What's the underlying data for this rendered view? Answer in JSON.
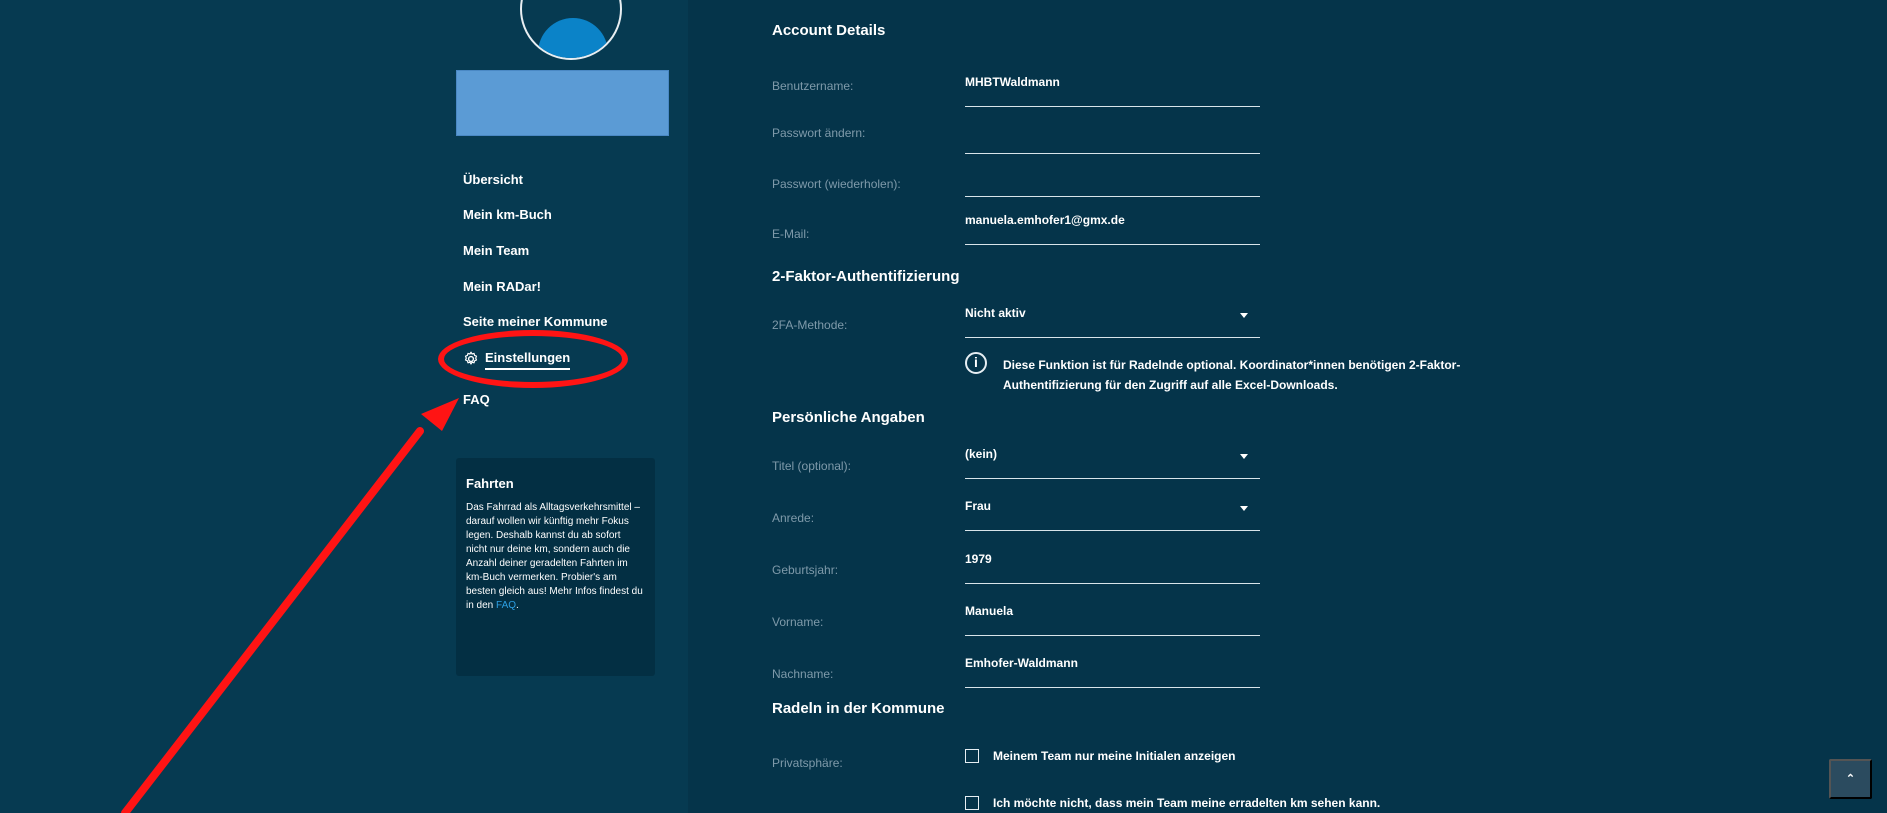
{
  "sidebar": {
    "nav": {
      "ubersicht": "Übersicht",
      "km_buch": "Mein km-Buch",
      "team": "Mein Team",
      "radar": "Mein RADar!",
      "kommune": "Seite meiner Kommune",
      "settings": "Einstellungen",
      "faq": "FAQ"
    },
    "info_card": {
      "title": "Fahrten",
      "text": "Das Fahrrad als Alltagsverkehrsmittel – darauf wollen wir künftig mehr Fokus legen. Deshalb kannst du ab sofort nicht nur deine km, sondern auch die Anzahl deiner geradelten Fahrten im km-Buch vermerken. Probier's am besten gleich aus! Mehr Infos findest du in den",
      "link": "FAQ",
      "suffix": "."
    }
  },
  "main": {
    "sections": {
      "account": "Account Details",
      "tfa": "2-Faktor-Authentifizierung",
      "personal": "Persönliche Angaben",
      "community": "Radeln in der Kommune"
    },
    "labels": {
      "username": "Benutzername:",
      "password_change": "Passwort ändern:",
      "password_repeat": "Passwort (wiederholen):",
      "email": "E-Mail:",
      "tfa_method": "2FA-Methode:",
      "title_optional": "Titel (optional):",
      "salutation": "Anrede:",
      "birth_year": "Geburtsjahr:",
      "first_name": "Vorname:",
      "last_name": "Nachname:",
      "privacy": "Privatsphäre:"
    },
    "values": {
      "username": "MHBTWaldmann",
      "password_change": "",
      "password_repeat": "",
      "email": "manuela.emhofer1@gmx.de",
      "tfa_method": "Nicht aktiv",
      "title_optional": "(kein)",
      "salutation": "Frau",
      "birth_year": "1979",
      "first_name": "Manuela",
      "last_name": "Emhofer-Waldmann"
    },
    "tfa_info": "Diese Funktion ist für Radelnde optional. Koordinator*innen benötigen 2-Faktor-Authentifizierung für den Zugriff auf alle Excel-Downloads.",
    "checkboxes": {
      "initials": "Meinem Team nur meine Initialen anzeigen",
      "hide_km": "Ich möchte nicht, dass mein Team meine erradelten km sehen kann."
    }
  },
  "icons": {
    "info": "info-icon",
    "settings": "gear-icon",
    "scroll_top": "chevron-up-icon"
  },
  "colors": {
    "background": "#05344a",
    "sidebar": "#063a51",
    "accent": "#0b83c8",
    "annotation": "#ff1414",
    "redaction": "#5b9bd5"
  }
}
